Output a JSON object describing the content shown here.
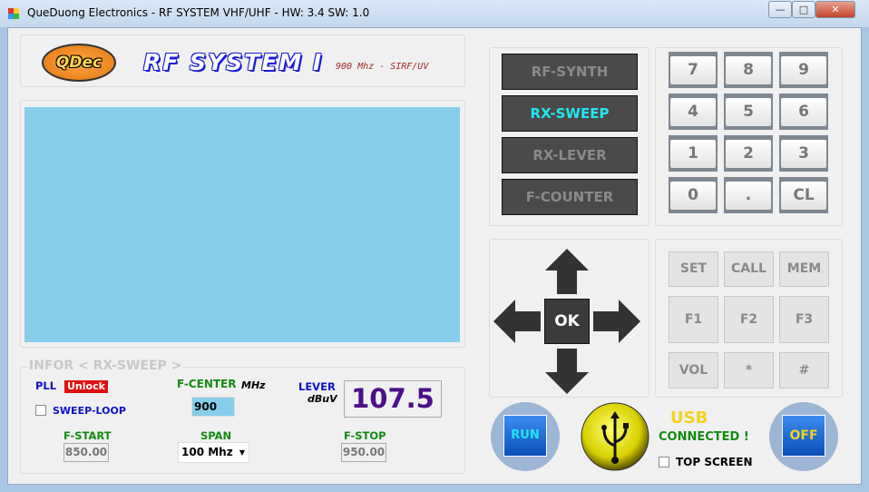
{
  "window": {
    "title": "QueDuong Electronics - RF SYSTEM VHF/UHF - HW: 3.4 SW: 1.0",
    "minimize": "—",
    "maximize": "□",
    "close": "✕"
  },
  "header": {
    "logo": "QDec",
    "title": "RF SYSTEM I",
    "subtitle": "900 Mhz - SIRF/UV"
  },
  "info": {
    "group_title": "INFOR < RX-SWEEP >",
    "pll_label": "PLL",
    "pll_status": "Unlock",
    "sweep_loop_label": "SWEEP-LOOP",
    "sweep_loop_checked": false,
    "f_center_label": "F-CENTER",
    "f_center_unit": "MHz",
    "f_center_value": "900",
    "lever_label": "LEVER",
    "lever_unit": "dBuV",
    "lever_value": "107.5",
    "f_start_label": "F-START",
    "f_start_value": "850.00",
    "span_label": "SPAN",
    "span_value": "100 Mhz",
    "f_stop_label": "F-STOP",
    "f_stop_value": "950.00"
  },
  "modes": [
    {
      "label": "RF-SYNTH",
      "active": false
    },
    {
      "label": "RX-SWEEP",
      "active": true
    },
    {
      "label": "RX-LEVER",
      "active": false
    },
    {
      "label": "F-COUNTER",
      "active": false
    }
  ],
  "keypad": [
    "7",
    "8",
    "9",
    "4",
    "5",
    "6",
    "1",
    "2",
    "3",
    "0",
    ".",
    "CL"
  ],
  "nav": {
    "ok": "OK"
  },
  "function_keys": [
    "SET",
    "CALL",
    "MEM",
    "F1",
    "F2",
    "F3",
    "VOL",
    "*",
    "#"
  ],
  "bottom": {
    "run": "RUN",
    "off": "OFF",
    "usb": "USB",
    "connected": "CONNECTED !",
    "top_screen": "TOP SCREEN",
    "top_screen_checked": false
  },
  "colors": {
    "display": "#87ceeb",
    "active_mode": "#22e6f0",
    "lever_value": "#4b0f8a",
    "unlock": "#e01010"
  }
}
